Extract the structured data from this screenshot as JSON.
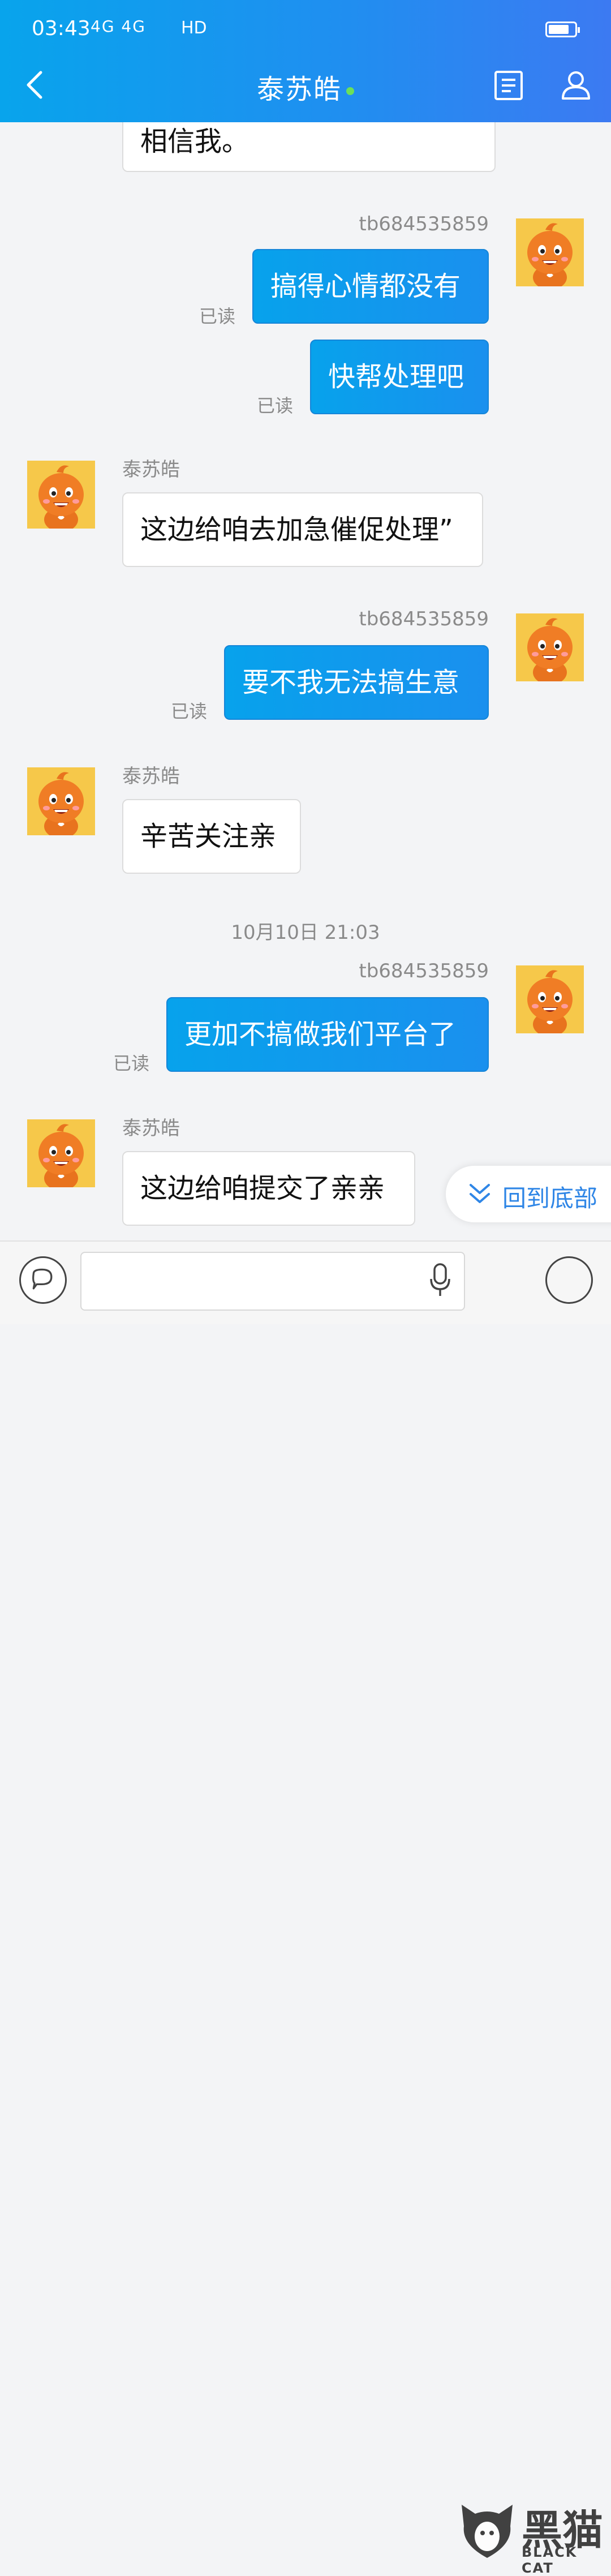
{
  "status_bar": {
    "time": "03:43",
    "signal": "4G 4G",
    "indicator": "HD",
    "battery_level": 0.8
  },
  "header": {
    "title": "泰苏皓",
    "online_color": "#6be05a"
  },
  "messages": {
    "m0": {
      "text": "相信我。"
    },
    "m1": {
      "sender": "tb684535859",
      "text": "搞得心情都没有",
      "status": "已读"
    },
    "m2": {
      "text": "快帮处理吧",
      "status": "已读"
    },
    "m3": {
      "sender": "泰苏皓",
      "text": "这边给咱去加急催促处理”"
    },
    "m4": {
      "sender": "tb684535859",
      "text": "要不我无法搞生意",
      "status": "已读"
    },
    "m5": {
      "sender": "泰苏皓",
      "text": "辛苦关注亲"
    },
    "timestamp": "10月10日 21:03",
    "m6": {
      "sender": "tb684535859",
      "text": "更加不搞做我们平台了",
      "status": "已读"
    },
    "m7": {
      "sender": "泰苏皓",
      "text": "这边给咱提交了亲亲"
    }
  },
  "scroll_button": {
    "label": "回到底部"
  },
  "composer": {
    "placeholder": ""
  },
  "watermark": {
    "cn": "黑猫",
    "en": "BLACK CAT"
  },
  "colors": {
    "header_gradient_start": "#08a4ec",
    "header_gradient_end": "#3c7af2",
    "bubble_sent": "#07a2ec",
    "accent_link": "#2f86e6"
  }
}
